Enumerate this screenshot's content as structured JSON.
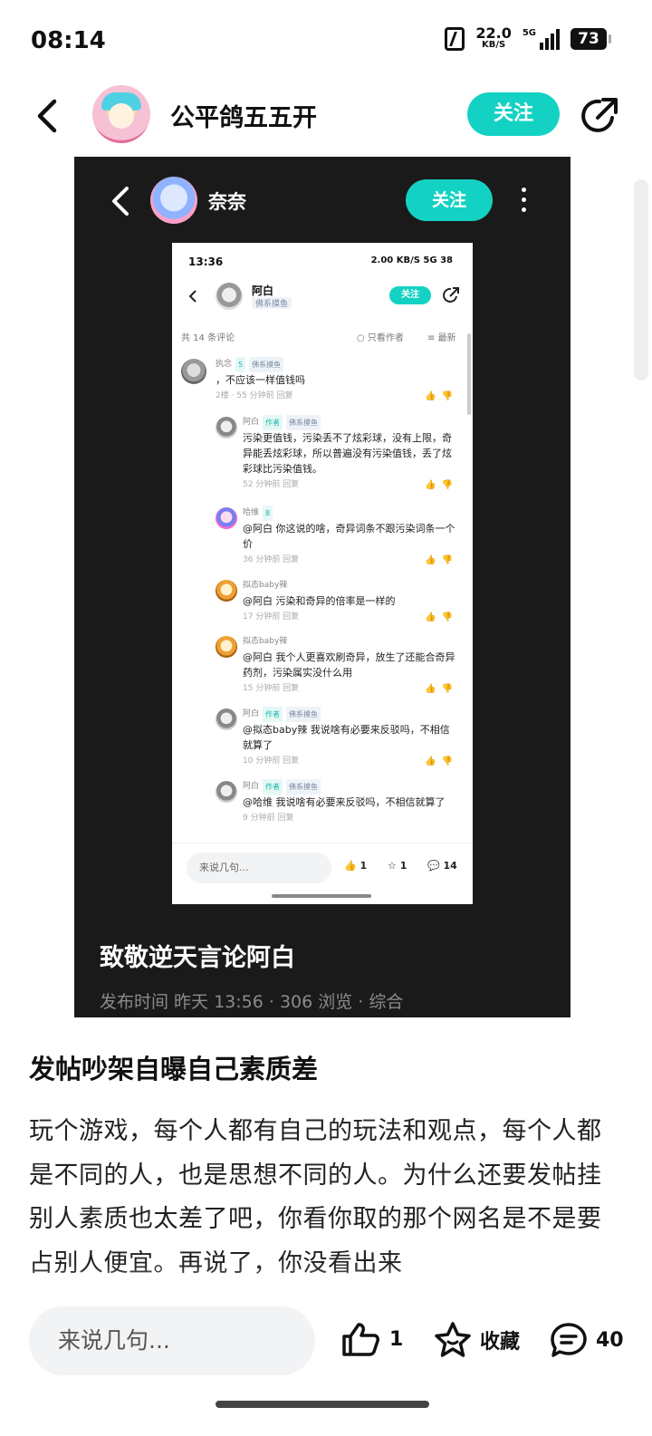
{
  "status_bar": {
    "time": "08:14",
    "net_speed": "22.0",
    "net_unit": "KB/S",
    "network": "5G",
    "battery": "73"
  },
  "header": {
    "author": "公平鸽五五开",
    "follow_label": "关注"
  },
  "embedded": {
    "header_name": "奈奈",
    "follow_label": "关注",
    "phone": {
      "time": "13:36",
      "status_right": "2.00 KB/S 5G 38",
      "author": "阿白",
      "author_tag": "佛系摸鱼",
      "follow_label": "关注",
      "comment_count": "共 14 条评论",
      "only_author": "只看作者",
      "sort": "最新",
      "comments": [
        {
          "user": "执念",
          "level": "5",
          "tag": "佛系摸鱼",
          "text": "，不应该一样值钱吗",
          "meta": "2楼 · 55 分钟前  回复"
        },
        {
          "user": "阿白",
          "author_badge": "作者",
          "tag": "佛系摸鱼",
          "text": "污染更值钱，污染丢不了炫彩球，没有上限，奇异能丢炫彩球，所以普遍没有污染值钱，丢了炫彩球比污染值钱。",
          "meta": "52 分钟前  回复"
        },
        {
          "user": "哈维",
          "level": "8",
          "text": "@阿白 你这说的啥，奇异词条不跟污染词条一个价",
          "meta": "36 分钟前  回复"
        },
        {
          "user": "拟态baby辣",
          "text": "@阿白 污染和奇异的倍率是一样的",
          "meta": "17 分钟前  回复"
        },
        {
          "user": "拟态baby辣",
          "text": "@阿白 我个人更喜欢刷奇异，放生了还能合奇异药剂，污染属实没什么用",
          "meta": "15 分钟前  回复"
        },
        {
          "user": "阿白",
          "author_badge": "作者",
          "tag": "佛系摸鱼",
          "text": "@拟态baby辣 我说啥有必要来反驳吗，不相信就算了",
          "meta": "10 分钟前  回复"
        },
        {
          "user": "阿白",
          "author_badge": "作者",
          "tag": "佛系摸鱼",
          "text": "@哈维 我说啥有必要来反驳吗，不相信就算了",
          "meta": "9 分钟前  回复"
        }
      ],
      "input_placeholder": "来说几句...",
      "likes": "1",
      "favs": "1",
      "comments_total": "14"
    },
    "title": "致敬逆天言论阿白",
    "meta": "发布时间 昨天 13:56 · 306 浏览 · 综合"
  },
  "post": {
    "title": "发帖吵架自曝自己素质差",
    "body": "玩个游戏，每个人都有自己的玩法和观点，每个人都是不同的人，也是思想不同的人。为什么还要发帖挂别人素质也太差了吧，你看你取的那个网名是不是要占别人便宜。再说了，你没看出来"
  },
  "bottom": {
    "input_placeholder": "来说几句...",
    "likes": "1",
    "fav_label": "收藏",
    "comments": "40"
  }
}
